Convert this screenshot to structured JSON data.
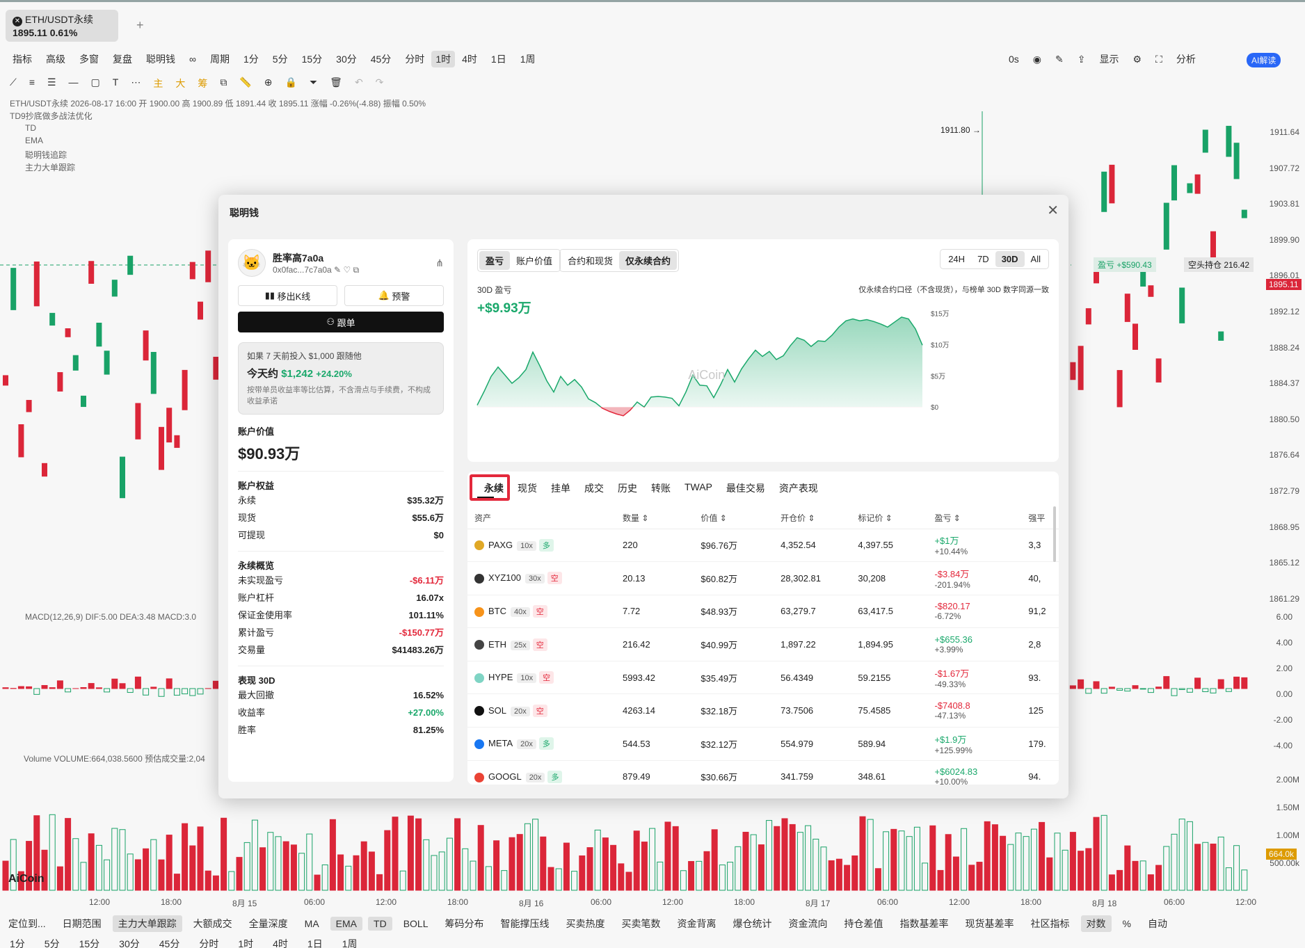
{
  "tab": {
    "title": "ETH/USDT永续",
    "price": "1895.11",
    "change": "0.61%"
  },
  "toolbar": {
    "left": [
      "指标",
      "高级",
      "多窗",
      "复盘",
      "聪明钱",
      "∞"
    ],
    "periods": [
      "周期",
      "1分",
      "5分",
      "15分",
      "30分",
      "45分",
      "分时",
      "1时",
      "4时",
      "1日",
      "1周"
    ],
    "active_period": "1时",
    "right": [
      "0s",
      "显示",
      "分析",
      "AI解读"
    ]
  },
  "chart_header": {
    "ohlc": "ETH/USDT永续 2026-08-17 16:00 开 1900.00 高 1900.89 低 1891.44 收 1895.11 涨幅 -0.26%(-4.88) 振幅 0.50%",
    "indicators": [
      "TD9抄底做多战法优化",
      "TD",
      "EMA",
      "聪明钱追踪",
      "主力大单跟踪"
    ],
    "macd": "MACD(12,26,9) DIF:5.00 DEA:3.48 MACD:3.0",
    "volume": "Volume VOLUME:664,038.5600 预估成交量:2,04",
    "peak_label": "1911.80 →",
    "position_tag": {
      "pnl": "盈亏 +$590.43",
      "pos": "空头持仓 216.42"
    },
    "current_price": "1895.11",
    "volume_tag": "664.0k"
  },
  "price_axis": [
    "1911.64",
    "1907.72",
    "1903.81",
    "1899.90",
    "1896.01",
    "1892.12",
    "1888.24",
    "1884.37",
    "1880.50",
    "1876.64",
    "1872.79",
    "1868.95",
    "1865.12",
    "1861.29"
  ],
  "macd_axis": [
    "6.00",
    "4.00",
    "2.00",
    "0.00",
    "-2.00",
    "-4.00"
  ],
  "vol_axis": [
    "2.00M",
    "1.50M",
    "1.00M",
    "500.00k"
  ],
  "time_axis": [
    "12:00",
    "18:00",
    "8月 15",
    "06:00",
    "12:00",
    "18:00",
    "8月 16",
    "06:00",
    "12:00",
    "18:00",
    "8月 17",
    "06:00",
    "12:00",
    "18:00",
    "8月 18",
    "06:00",
    "12:00"
  ],
  "watermark": "AiCoin",
  "bottom_tools": [
    "定位到...",
    "日期范围",
    "主力大单跟踪",
    "大额成交",
    "全量深度",
    "MA",
    "EMA",
    "TD",
    "BOLL",
    "筹码分布",
    "智能撑压线",
    "买卖热度",
    "买卖笔数",
    "资金背离",
    "爆仓统计",
    "资金流向",
    "持仓差值",
    "指数基差率",
    "现货基差率",
    "社区指标",
    "对数",
    "%",
    "自动"
  ],
  "bottom_periods": [
    "1分",
    "5分",
    "15分",
    "30分",
    "45分",
    "分时",
    "1时",
    "4时",
    "1日",
    "1周"
  ],
  "modal": {
    "title": "聪明钱",
    "profile": {
      "name": "胜率高7a0a",
      "address": "0x0fac...7c7a0a",
      "btn_kline": "移出K线",
      "btn_alert": "预警",
      "btn_follow": "跟单",
      "sim_line1": "如果 7 天前投入 $1,000 跟随他",
      "sim_label": "今天约",
      "sim_value": "$1,242",
      "sim_pct": "+24.20%",
      "sim_note": "按带单员收益率等比估算，不含滑点与手续费，不构成收益承诺"
    },
    "account_value_label": "账户价值",
    "account_value": "$90.93万",
    "equity": {
      "title": "账户权益",
      "rows": [
        [
          "永续",
          "$35.32万"
        ],
        [
          "现货",
          "$55.6万"
        ],
        [
          "可提现",
          "$0"
        ]
      ]
    },
    "perp": {
      "title": "永续概览",
      "rows": [
        [
          "未实现盈亏",
          "-$6.11万"
        ],
        [
          "账户杠杆",
          "16.07x"
        ],
        [
          "保证金使用率",
          "101.11%"
        ],
        [
          "累计盈亏",
          "-$150.77万"
        ],
        [
          "交易量",
          "$41483.26万"
        ]
      ]
    },
    "perf": {
      "title": "表现 30D",
      "rows": [
        [
          "最大回撤",
          "16.52%"
        ],
        [
          "收益率",
          "+27.00%"
        ],
        [
          "胜率",
          "81.25%"
        ]
      ]
    },
    "chart_tabs": [
      "盈亏",
      "账户价值"
    ],
    "scope_tabs": [
      "合约和现货",
      "仅永续合约"
    ],
    "range_tabs": [
      "24H",
      "7D",
      "30D",
      "All"
    ],
    "pnl_label": "30D 盈亏",
    "pnl_value": "+$9.93万",
    "pnl_note": "仅永续合约口径（不含现货），与榜单 30D 数字同源一致",
    "chart_data": {
      "type": "area",
      "y_ticks": [
        "$15万",
        "$10万",
        "$5万",
        "$0"
      ],
      "ylim": [
        -1.2,
        15.5
      ],
      "values": [
        0.3,
        2.5,
        4.9,
        6.4,
        5.1,
        3.8,
        4.7,
        6.0,
        8.8,
        6.6,
        4.2,
        2.4,
        4.9,
        3.5,
        4.4,
        3.2,
        1.3,
        0.7,
        -0.2,
        -0.7,
        -1.1,
        -1.4,
        -0.5,
        0.8,
        0.0,
        1.6,
        1.7,
        1.6,
        1.4,
        0.2,
        2.4,
        5.1,
        3.5,
        3.4,
        1.5,
        3.6,
        6.0,
        4.0,
        6.1,
        7.7,
        9.1,
        8.1,
        8.9,
        7.6,
        8.2,
        9.8,
        11.1,
        10.7,
        9.7,
        10.6,
        10.5,
        11.5,
        12.8,
        13.8,
        14.1,
        13.8,
        14.0,
        13.7,
        13.3,
        12.8,
        13.6,
        14.4,
        14.1,
        12.5,
        9.9
      ]
    },
    "pos_tabs": [
      "永续",
      "现货",
      "挂单",
      "成交",
      "历史",
      "转账",
      "TWAP",
      "最佳交易",
      "资产表现"
    ],
    "pos_headers": [
      "资产",
      "数量",
      "价值",
      "开仓价",
      "标记价",
      "盈亏",
      "强平"
    ],
    "positions": [
      {
        "asset": "PAXG",
        "lev": "10x",
        "dir": "多",
        "qty": "220",
        "value": "$96.76万",
        "entry": "4,352.54",
        "mark": "4,397.55",
        "pnl": "+$1万",
        "pct": "+10.44%",
        "liq": "3,3",
        "color": "#e0a826"
      },
      {
        "asset": "XYZ100",
        "lev": "30x",
        "dir": "空",
        "qty": "20.13",
        "value": "$60.82万",
        "entry": "28,302.81",
        "mark": "30,208",
        "pnl": "-$3.84万",
        "pct": "-201.94%",
        "liq": "40,",
        "color": "#333"
      },
      {
        "asset": "BTC",
        "lev": "40x",
        "dir": "空",
        "qty": "7.72",
        "value": "$48.93万",
        "entry": "63,279.7",
        "mark": "63,417.5",
        "pnl": "-$820.17",
        "pct": "-6.72%",
        "liq": "91,2",
        "color": "#f7931a"
      },
      {
        "asset": "ETH",
        "lev": "25x",
        "dir": "空",
        "qty": "216.42",
        "value": "$40.99万",
        "entry": "1,897.22",
        "mark": "1,894.95",
        "pnl": "+$655.36",
        "pct": "+3.99%",
        "liq": "2,8",
        "color": "#444"
      },
      {
        "asset": "HYPE",
        "lev": "10x",
        "dir": "空",
        "qty": "5993.42",
        "value": "$35.49万",
        "entry": "56.4349",
        "mark": "59.2155",
        "pnl": "-$1.67万",
        "pct": "-49.33%",
        "liq": "93.",
        "color": "#7fd4c4"
      },
      {
        "asset": "SOL",
        "lev": "20x",
        "dir": "空",
        "qty": "4263.14",
        "value": "$32.18万",
        "entry": "73.7506",
        "mark": "75.4585",
        "pnl": "-$7408.8",
        "pct": "-47.13%",
        "liq": "125",
        "color": "#111"
      },
      {
        "asset": "META",
        "lev": "20x",
        "dir": "多",
        "qty": "544.53",
        "value": "$32.12万",
        "entry": "554.979",
        "mark": "589.94",
        "pnl": "+$1.9万",
        "pct": "+125.99%",
        "liq": "179.",
        "color": "#1877f2"
      },
      {
        "asset": "GOOGL",
        "lev": "20x",
        "dir": "多",
        "qty": "879.49",
        "value": "$30.66万",
        "entry": "341.759",
        "mark": "348.61",
        "pnl": "+$6024.83",
        "pct": "+10.00%",
        "liq": "94.",
        "color": "#ea4335"
      }
    ]
  }
}
